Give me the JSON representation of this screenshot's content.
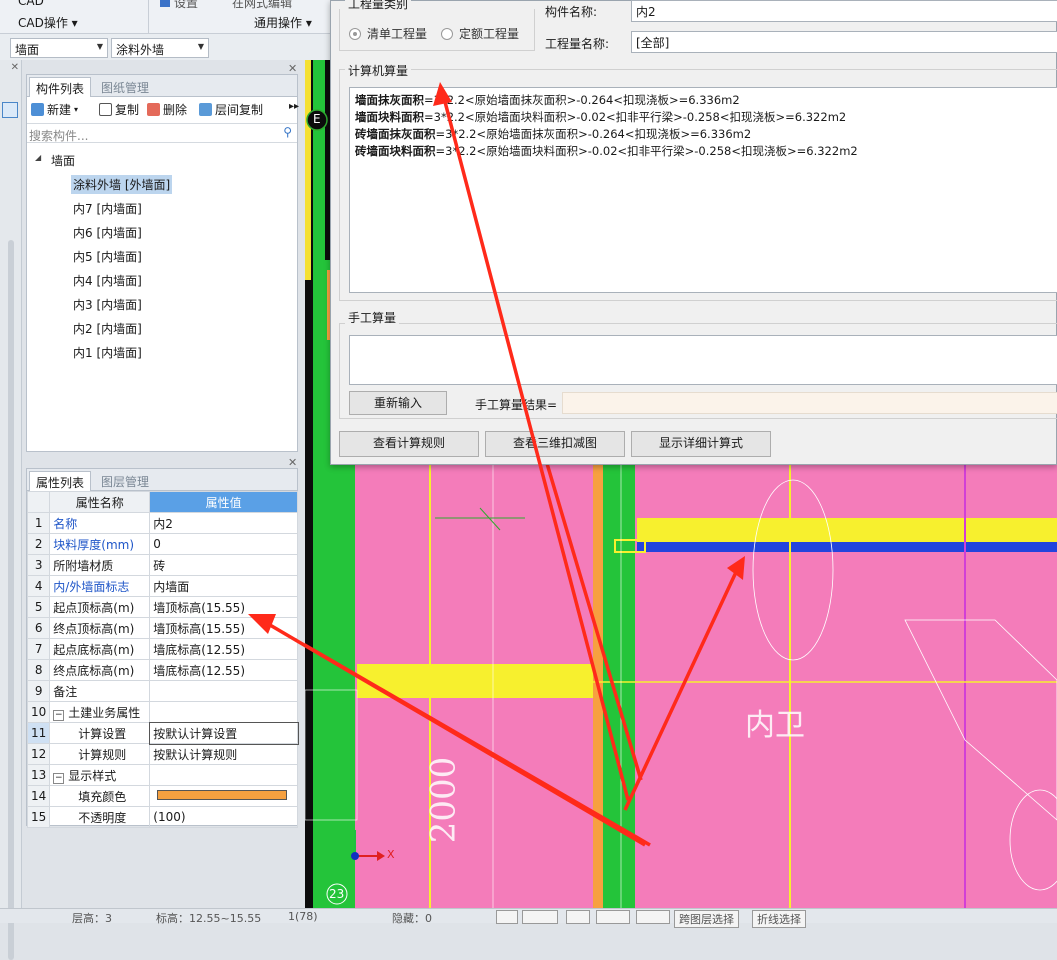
{
  "ribbon": {
    "cad_top": "CAD",
    "cad_ops": "CAD操作",
    "common_ops": "通用操作",
    "settings_partial": "设置",
    "top_partial2": "在网式编辑"
  },
  "selectors": {
    "category": "墙面",
    "component": "涂料外墙"
  },
  "component_panel": {
    "tabs": [
      "构件列表",
      "图纸管理"
    ],
    "toolbar": {
      "new": "新建",
      "copy": "复制",
      "delete": "删除",
      "floor_copy": "层间复制"
    },
    "search_placeholder": "搜索构件...",
    "root": "墙面",
    "items": [
      "涂料外墙 [外墙面]",
      "内7 [内墙面]",
      "内6 [内墙面]",
      "内5 [内墙面]",
      "内4 [内墙面]",
      "内3 [内墙面]",
      "内2 [内墙面]",
      "内1 [内墙面]"
    ]
  },
  "property_panel": {
    "tabs": [
      "属性列表",
      "图层管理"
    ],
    "col_name": "属性名称",
    "col_value": "属性值",
    "rows": [
      {
        "n": "1",
        "name": "名称",
        "value": "内2",
        "blue": true
      },
      {
        "n": "2",
        "name": "块料厚度(mm)",
        "value": "0",
        "blue": true
      },
      {
        "n": "3",
        "name": "所附墙材质",
        "value": "砖",
        "blue": false
      },
      {
        "n": "4",
        "name": "内/外墙面标志",
        "value": "内墙面",
        "blue": true
      },
      {
        "n": "5",
        "name": "起点顶标高(m)",
        "value": "墙顶标高(15.55)",
        "blue": false
      },
      {
        "n": "6",
        "name": "终点顶标高(m)",
        "value": "墙顶标高(15.55)",
        "blue": false
      },
      {
        "n": "7",
        "name": "起点底标高(m)",
        "value": "墙底标高(12.55)",
        "blue": false
      },
      {
        "n": "8",
        "name": "终点底标高(m)",
        "value": "墙底标高(12.55)",
        "blue": false
      },
      {
        "n": "9",
        "name": "备注",
        "value": "",
        "blue": false
      },
      {
        "n": "10",
        "name": "土建业务属性",
        "value": "",
        "blue": false
      },
      {
        "n": "11",
        "name": "计算设置",
        "value": "按默认计算设置",
        "blue": false
      },
      {
        "n": "12",
        "name": "计算规则",
        "value": "按默认计算规则",
        "blue": false
      },
      {
        "n": "13",
        "name": "显示样式",
        "value": "",
        "blue": false
      },
      {
        "n": "14",
        "name": "填充颜色",
        "value": "",
        "blue": false
      },
      {
        "n": "15",
        "name": "不透明度",
        "value": "(100)",
        "blue": false
      }
    ],
    "fill_color": "#f5a040"
  },
  "dialog": {
    "qty_type_label": "工程量类别",
    "radio_list": "清单工程量",
    "radio_quota": "定额工程量",
    "component_name_label": "构件名称:",
    "component_name_value": "内2",
    "qty_name_label": "工程量名称:",
    "qty_name_value": "[全部]",
    "computer_calc_label": "计算机算量",
    "calc_lines": [
      {
        "k": "墙面抹灰面积",
        "v": "=3*2.2<原始墙面抹灰面积>-0.264<扣现浇板>=6.336m2"
      },
      {
        "k": "墙面块料面积",
        "v": "=3*2.2<原始墙面块料面积>-0.02<扣非平行梁>-0.258<扣现浇板>=6.322m2"
      },
      {
        "k": "砖墙面抹灰面积",
        "v": "=3*2.2<原始墙面抹灰面积>-0.264<扣现浇板>=6.336m2"
      },
      {
        "k": "砖墙面块料面积",
        "v": "=3*2.2<原始墙面块料面积>-0.02<扣非平行梁>-0.258<扣现浇板>=6.322m2"
      }
    ],
    "manual_calc_label": "手工算量",
    "reinput": "重新输入",
    "manual_result_label": "手工算量结果=",
    "btn_rules": "查看计算规则",
    "btn_3d": "查看三维扣减图",
    "btn_detail": "显示详细计算式"
  },
  "canvas": {
    "axis_e": "E",
    "axis_23": "23",
    "dim_2000": "2000",
    "room_label": "内卫",
    "x_axis": "X"
  },
  "status": {
    "floor": "层高：3",
    "elev": "标高：12.55~15.55",
    "count": "1(78)",
    "hidden": "隐藏：0",
    "btn_cross": "跨图层选择",
    "btn_polyline": "折线选择"
  }
}
